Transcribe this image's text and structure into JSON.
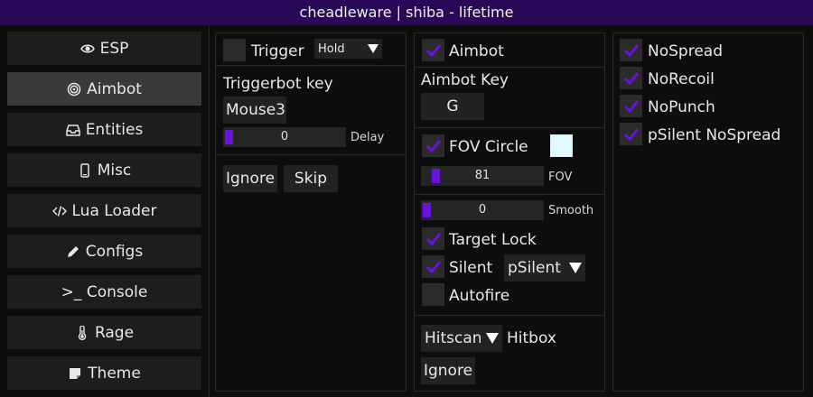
{
  "window": {
    "title": "cheadleware | shiba - lifetime"
  },
  "colors": {
    "accent": "#6a11e0",
    "titlebar": "#2a0858",
    "swatch": "#e0fbff"
  },
  "sidebar": {
    "items": [
      {
        "label": "ESP",
        "icon": "eye-icon",
        "active": false
      },
      {
        "label": "Aimbot",
        "icon": "target-icon",
        "active": true
      },
      {
        "label": "Entities",
        "icon": "inbox-icon",
        "active": false
      },
      {
        "label": "Misc",
        "icon": "phone-icon",
        "active": false
      },
      {
        "label": "Lua Loader",
        "icon": "code-icon",
        "active": false
      },
      {
        "label": "Configs",
        "icon": "pencil-icon",
        "active": false
      },
      {
        "label": ">_ Console",
        "icon": "",
        "active": false
      },
      {
        "label": "Rage",
        "icon": "thermometer-icon",
        "active": false
      },
      {
        "label": "Theme",
        "icon": "note-icon",
        "active": false
      }
    ]
  },
  "triggerbot": {
    "trigger_label": "Trigger",
    "trigger_checked": false,
    "mode": "Hold",
    "key_label": "Triggerbot key",
    "key_value": "Mouse3",
    "delay_value": "0",
    "delay_label": "Delay",
    "ignore_label": "Ignore",
    "skip_label": "Skip"
  },
  "aimbot": {
    "aimbot_label": "Aimbot",
    "aimbot_checked": true,
    "key_label": "Aimbot Key",
    "key_value": "G",
    "fov_circle_label": "FOV Circle",
    "fov_circle_checked": true,
    "fov_value": "81",
    "fov_label": "FOV",
    "smooth_value": "0",
    "smooth_label": "Smooth",
    "target_lock_label": "Target Lock",
    "target_lock_checked": true,
    "silent_label": "Silent",
    "silent_checked": true,
    "silent_mode": "pSilent",
    "autofire_label": "Autofire",
    "autofire_checked": false,
    "hitbox_value": "Hitscan",
    "hitbox_label": "Hitbox",
    "ignore_label": "Ignore"
  },
  "misc": {
    "options": [
      {
        "label": "NoSpread",
        "checked": true
      },
      {
        "label": "NoRecoil",
        "checked": true
      },
      {
        "label": "NoPunch",
        "checked": true
      },
      {
        "label": "pSilent NoSpread",
        "checked": true
      }
    ]
  }
}
